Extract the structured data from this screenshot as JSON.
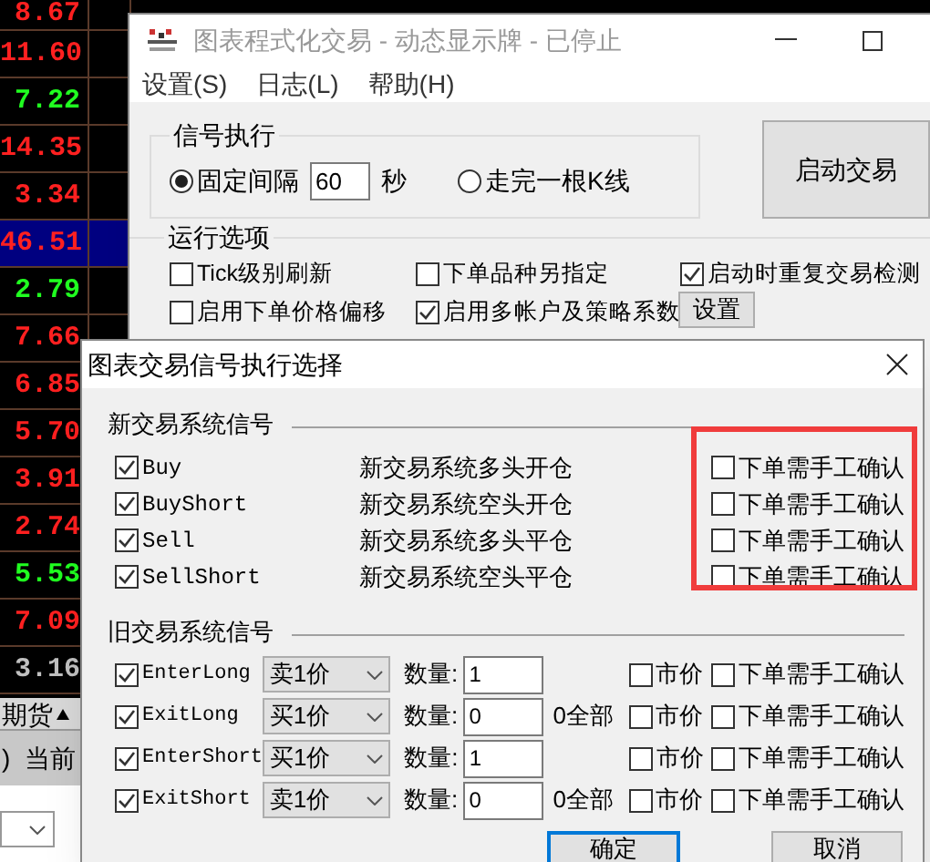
{
  "quotes": [
    {
      "value": "8.67",
      "color": "#ff2020",
      "selected": false
    },
    {
      "value": "11.60",
      "color": "#ff2020",
      "selected": false
    },
    {
      "value": "7.22",
      "color": "#20ff20",
      "selected": false
    },
    {
      "value": "14.35",
      "color": "#ff2020",
      "selected": false
    },
    {
      "value": "3.34",
      "color": "#ff2020",
      "selected": false
    },
    {
      "value": "46.51",
      "color": "#ff2020",
      "selected": true
    },
    {
      "value": "2.79",
      "color": "#20ff20",
      "selected": false
    },
    {
      "value": "7.66",
      "color": "#ff2020",
      "selected": false
    },
    {
      "value": "6.85",
      "color": "#ff2020",
      "selected": false
    },
    {
      "value": "5.70",
      "color": "#ff2020",
      "selected": false
    },
    {
      "value": "3.91",
      "color": "#ff2020",
      "selected": false
    },
    {
      "value": "2.74",
      "color": "#ff2020",
      "selected": false
    },
    {
      "value": "5.53",
      "color": "#20ff20",
      "selected": false
    },
    {
      "value": "7.09",
      "color": "#ff2020",
      "selected": false
    },
    {
      "value": "3.16",
      "color": "#c0c0c0",
      "selected": false
    }
  ],
  "bottom_panel": {
    "tab": "期货",
    "bar_text_1": ")",
    "bar_text_2": "当前"
  },
  "main_window": {
    "title": "图表程式化交易 - 动态显示牌 - 已停止",
    "menu": [
      "设置(S)",
      "日志(L)",
      "帮助(H)"
    ],
    "signal_group": {
      "title": "信号执行",
      "options": [
        {
          "label": "固定间隔",
          "selected": true
        },
        {
          "label": "走完一根K线",
          "selected": false
        }
      ],
      "interval": "60",
      "unit": "秒"
    },
    "start_button": "启动交易",
    "run_options": {
      "title": "运行选项",
      "items": [
        {
          "label": "Tick级别刷新",
          "checked": false
        },
        {
          "label": "下单品种另指定",
          "checked": false
        },
        {
          "label": "启动时重复交易检测",
          "checked": true
        },
        {
          "label": "启用下单价格偏移",
          "checked": false
        },
        {
          "label": "启用多帐户及策略系数",
          "checked": true
        }
      ],
      "settings_button": "设置"
    }
  },
  "dialog": {
    "title": "图表交易信号执行选择",
    "new_group": {
      "title": "新交易系统信号",
      "rows": [
        {
          "name": "Buy",
          "checked": true,
          "description": "新交易系统多头开仓",
          "confirm_label": "下单需手工确认",
          "confirm": false
        },
        {
          "name": "BuyShort",
          "checked": true,
          "description": "新交易系统空头开仓",
          "confirm_label": "下单需手工确认",
          "confirm": false
        },
        {
          "name": "Sell",
          "checked": true,
          "description": "新交易系统多头平仓",
          "confirm_label": "下单需手工确认",
          "confirm": false
        },
        {
          "name": "SellShort",
          "checked": true,
          "description": "新交易系统空头平仓",
          "confirm_label": "下单需手工确认",
          "confirm": false
        }
      ]
    },
    "old_group": {
      "title": "旧交易系统信号",
      "rows": [
        {
          "name": "EnterLong",
          "checked": true,
          "price": "卖1价",
          "qty_label": "数量:",
          "qty": "1",
          "market_label": "市价",
          "market": false,
          "confirm_label": "下单需手工确认",
          "confirm": false
        },
        {
          "name": "ExitLong",
          "checked": true,
          "price": "买1价",
          "qty_label": "数量:",
          "qty": "0",
          "all_note": "0全部",
          "market_label": "市价",
          "market": false,
          "confirm_label": "下单需手工确认",
          "confirm": false
        },
        {
          "name": "EnterShort",
          "checked": true,
          "price": "买1价",
          "qty_label": "数量:",
          "qty": "1",
          "market_label": "市价",
          "market": false,
          "confirm_label": "下单需手工确认",
          "confirm": false
        },
        {
          "name": "ExitShort",
          "checked": true,
          "price": "卖1价",
          "qty_label": "数量:",
          "qty": "0",
          "all_note": "0全部",
          "market_label": "市价",
          "market": false,
          "confirm_label": "下单需手工确认",
          "confirm": false
        }
      ]
    },
    "ok_button": "确定",
    "cancel_button": "取消"
  }
}
